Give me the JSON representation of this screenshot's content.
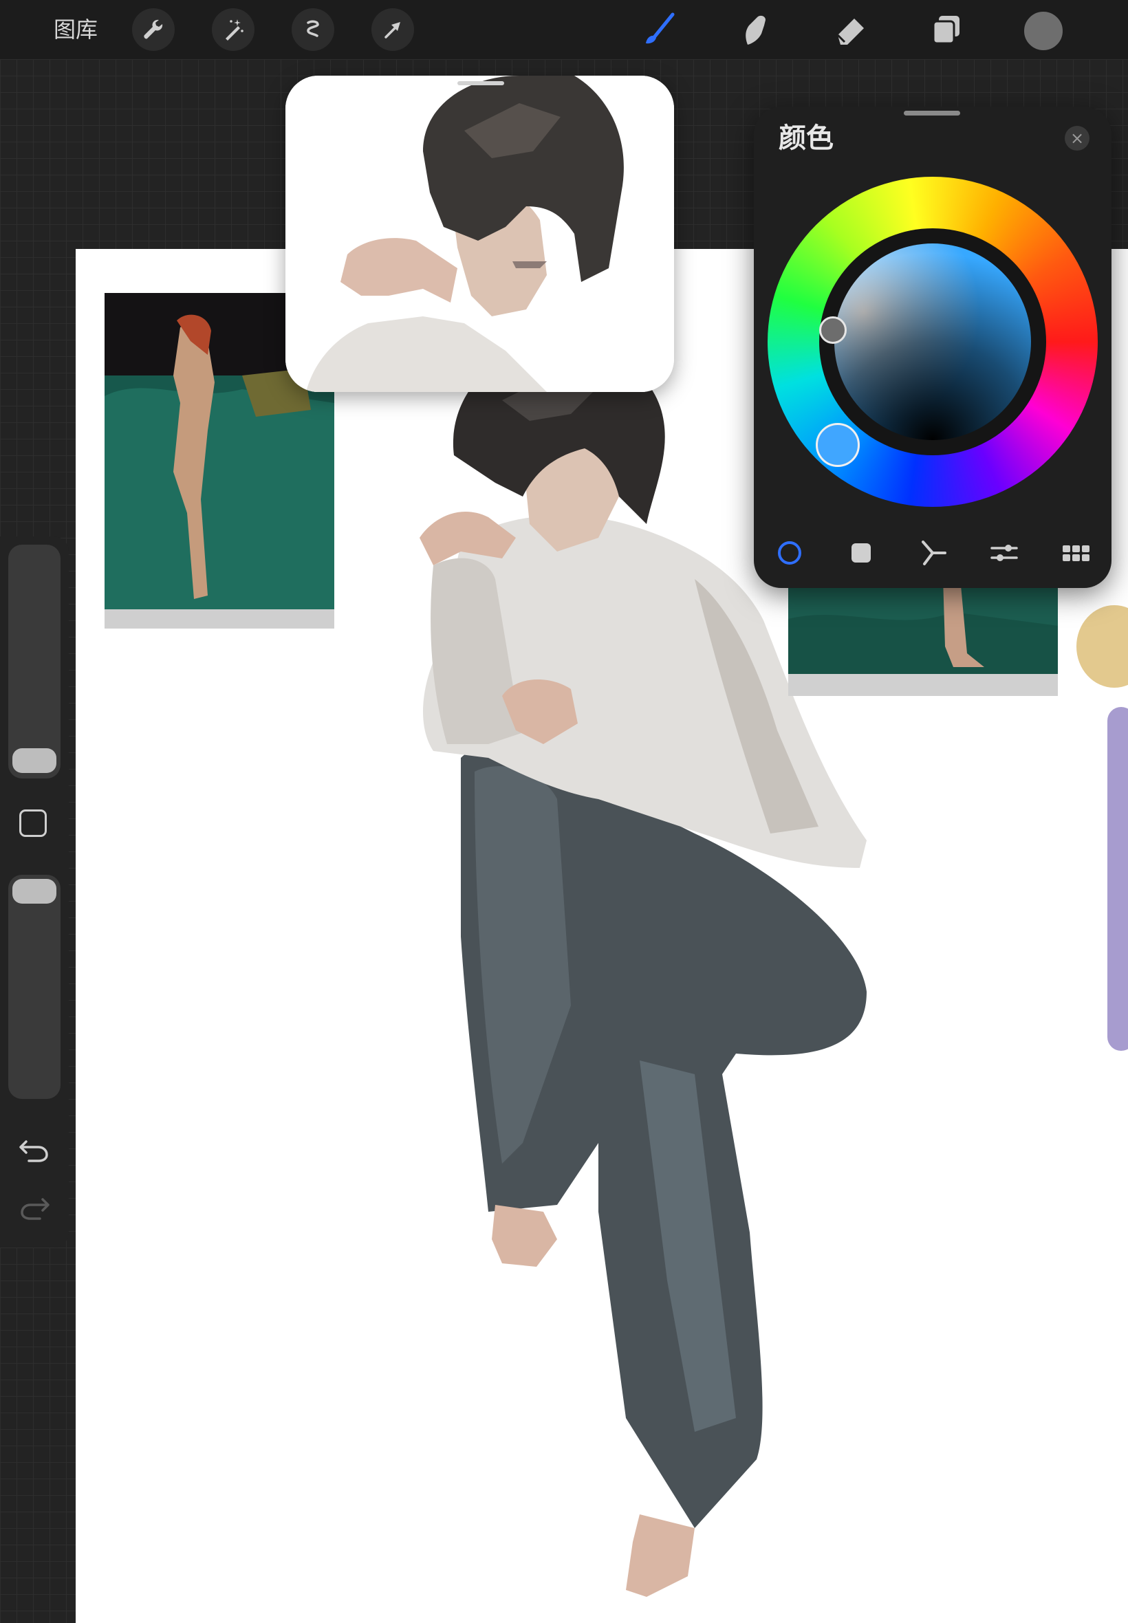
{
  "toolbar": {
    "gallery_label": "图库",
    "left_tools": [
      {
        "icon": "wrench-icon",
        "name": "actions"
      },
      {
        "icon": "magic-wand-icon",
        "name": "adjustments"
      },
      {
        "icon": "selection-icon",
        "name": "selection"
      },
      {
        "icon": "arrow-cursor-icon",
        "name": "transform"
      }
    ],
    "right_tools": [
      {
        "icon": "brush-icon",
        "name": "paint",
        "active": true
      },
      {
        "icon": "smudge-icon",
        "name": "smudge"
      },
      {
        "icon": "eraser-icon",
        "name": "eraser"
      },
      {
        "icon": "layers-icon",
        "name": "layers"
      }
    ],
    "current_color": "#6e6e6e",
    "active_tool_color": "#2f6fff"
  },
  "color_panel": {
    "title": "颜色",
    "close_symbol": "×",
    "selected_hue_color": "#40a6ff",
    "selected_color": "#6d6d6d",
    "modes": [
      {
        "icon": "disc-icon",
        "name": "disc",
        "active": true
      },
      {
        "icon": "square-icon",
        "name": "classic"
      },
      {
        "icon": "harmony-icon",
        "name": "harmony"
      },
      {
        "icon": "sliders-icon",
        "name": "value"
      },
      {
        "icon": "palette-grid-icon",
        "name": "palettes"
      }
    ]
  },
  "sidebar": {
    "brush_size_level": 0.08,
    "opacity_level": 0.95,
    "undo_icon": "undo-icon",
    "redo_icon": "redo-icon",
    "modify_icon": "square-outline-icon"
  },
  "canvas": {
    "background": "#ffffff"
  }
}
